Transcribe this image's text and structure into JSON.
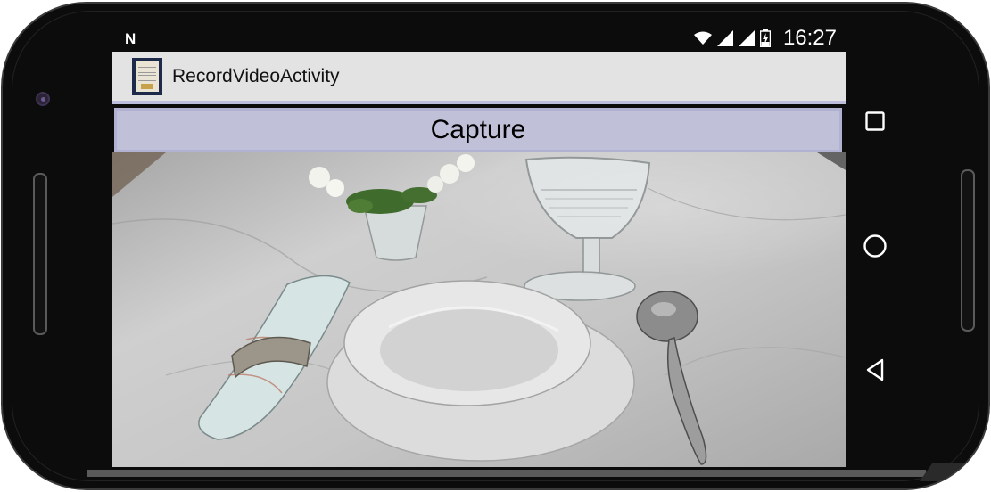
{
  "status_bar": {
    "notification_icon": "N",
    "clock": "16:27",
    "icons": [
      "wifi-icon",
      "signal-icon",
      "signal-icon",
      "battery-charging-icon"
    ]
  },
  "app_bar": {
    "title": "RecordVideoActivity",
    "icon": "app-launcher-icon"
  },
  "capture_button": {
    "label": "Capture"
  },
  "camera_preview": {
    "subject": "table setting"
  },
  "nav_bar": {
    "buttons": [
      "recents-icon",
      "home-icon",
      "back-icon"
    ]
  },
  "colors": {
    "appbar": "#e3e3e3",
    "button": "#c0c0d8",
    "phone": "#0c0c0c"
  }
}
